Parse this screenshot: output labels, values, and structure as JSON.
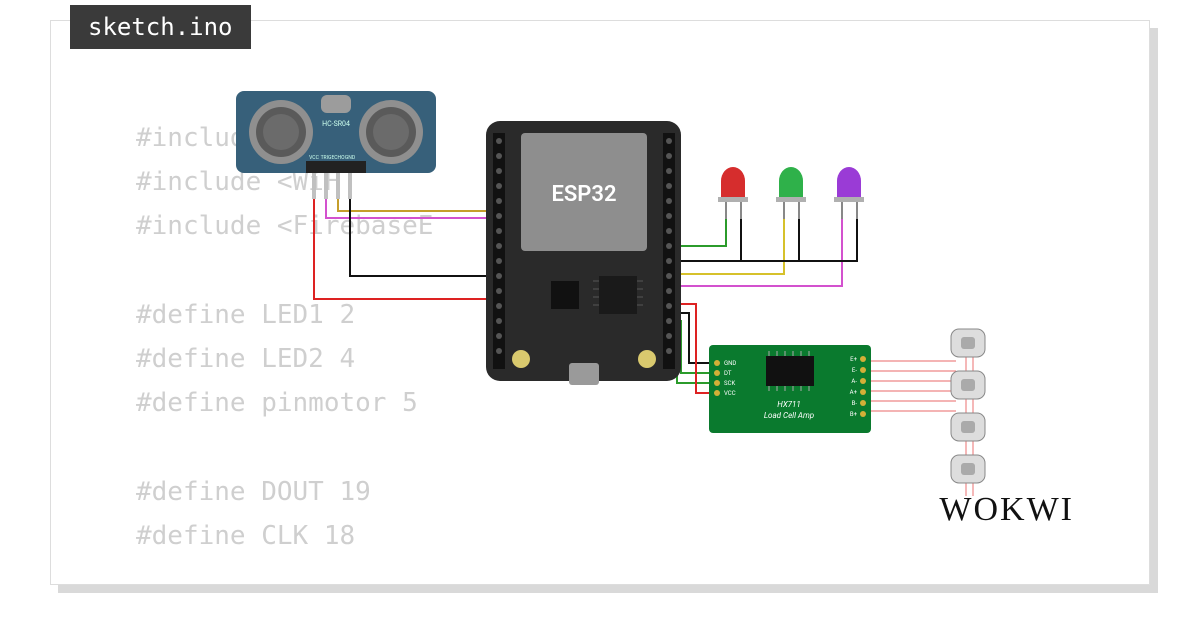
{
  "tab_label": "sketch.ino",
  "code_text": "#include <HX7\n#include <WiF\n#include <FirebaseE    32.h>\n\n#define LED1 2\n#define LED2 4\n#define pinmotor 5\n\n#define DOUT 19\n#define CLK 18",
  "logo_text": "WOKWI",
  "components": {
    "hcsr04": {
      "label": "HC-SR04",
      "pins": [
        "VCC",
        "TRIG",
        "ECHO",
        "GND"
      ]
    },
    "esp32": {
      "label": "ESP32"
    },
    "hx711": {
      "title": "HX711",
      "subtitle": "Load Cell Amp",
      "left_pins": [
        "GND",
        "DT",
        "SCK",
        "VCC"
      ],
      "right_pins": [
        "E+",
        "E-",
        "A-",
        "A+",
        "B-",
        "B+"
      ]
    },
    "leds": [
      {
        "name": "led-red",
        "color": "#d62d2d"
      },
      {
        "name": "led-green",
        "color": "#2fb14a"
      },
      {
        "name": "led-purple",
        "color": "#9a3bd6"
      }
    ],
    "load_cells": 4
  },
  "wires": [
    {
      "name": "hcsr04-vcc-to-esp32",
      "color": "#d22"
    },
    {
      "name": "hcsr04-trig-to-esp32",
      "color": "#d351ce"
    },
    {
      "name": "hcsr04-echo-to-esp32",
      "color": "#c59e2b"
    },
    {
      "name": "hcsr04-gnd-to-esp32",
      "color": "#111"
    },
    {
      "name": "led-red-anode",
      "color": "#2b9b2b"
    },
    {
      "name": "led-red-cathode",
      "color": "#111"
    },
    {
      "name": "led-green-anode",
      "color": "#d6c12b"
    },
    {
      "name": "led-green-cathode",
      "color": "#111"
    },
    {
      "name": "led-purple-anode",
      "color": "#d351ce"
    },
    {
      "name": "led-purple-cathode",
      "color": "#111"
    },
    {
      "name": "esp32-to-hx711-gnd",
      "color": "#111"
    },
    {
      "name": "esp32-to-hx711-dt",
      "color": "#2b9b2b"
    },
    {
      "name": "esp32-to-hx711-sck",
      "color": "#2b9b2b"
    },
    {
      "name": "esp32-to-hx711-vcc",
      "color": "#d22"
    },
    {
      "name": "hx711-to-loadcells",
      "color": "#e88"
    }
  ]
}
